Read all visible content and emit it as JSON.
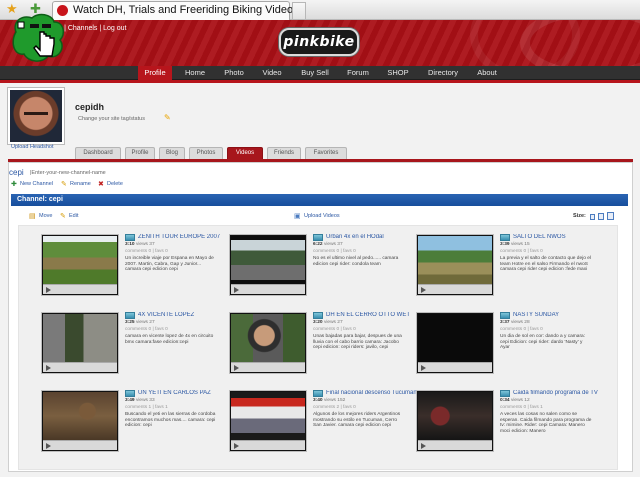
{
  "browser": {
    "tab_title": "Watch DH, Trials and Freeriding Biking Videos"
  },
  "header": {
    "logo_text": "pinkbike",
    "account_links": "...ops | Channels | Log out"
  },
  "nav": {
    "items": [
      "Profile",
      "Home",
      "Photo",
      "Video",
      "Buy Sell",
      "Forum",
      "SHOP",
      "Directory",
      "About"
    ],
    "active": "Profile"
  },
  "profile": {
    "username": "cepidh",
    "tagline": "Change your site tag/status",
    "upload_headshot": "Upload Headshot",
    "tabs": [
      "Dashboard",
      "Profile",
      "Blog",
      "Photos",
      "Videos",
      "Friends",
      "Favorites"
    ],
    "active_tab": "Videos"
  },
  "channel": {
    "name": "cepi",
    "enter_name": "|Enter-your-new-channel-name",
    "actions": [
      "New Channel",
      "Rename",
      "Delete"
    ],
    "bar_title": "Channel: cepi",
    "toolbar": {
      "move": "Move",
      "edit": "Edit",
      "upload": "Upload Videos",
      "size": "Size:"
    }
  },
  "videos": [
    {
      "title": "ZENITH TOUR EUROPE 2007",
      "length": "3:10",
      "views": "views 37",
      "comments": "comments 0 | favs 0",
      "desc": "Un increible viaje por Espana en Mayo de 2007. Martin, Cabra, Gap y Junior... camara cepi edicion cepi"
    },
    {
      "title": "Urban 4x en el HOdal",
      "length": "6:22",
      "views": "views 37",
      "comments": "comments 0 | favs 0",
      "desc": "No es el ultimo nivel al pedo...... camara edicion cepi rider: condola team"
    },
    {
      "title": "SALTO DEL NWOS",
      "length": "3:39",
      "views": "views 15",
      "comments": "comments 0 | favs 0",
      "desc": "La previa y el salto de contacto que dejo el team Hotre en el salso Firmando el nwoS camara cepi rider cepi edicion :fede maxi"
    },
    {
      "title": "4X VICENTE LOPEZ",
      "length": "3:25",
      "views": "views 27",
      "comments": "comments 0 | favs 0",
      "desc": "camara en vicente lopez de 4x en circuito bmx camara:fase edicion:cepi"
    },
    {
      "title": "DH EN EL CERRO OTTO WET",
      "length": "3:20",
      "views": "views 27",
      "comments": "comments 0 | favs 0",
      "desc": "Unas bajadas para bajar, despues de una lluvia con el cabo barrio camara: Jacobo cepi edicion: cepi riders: javilo, cepi"
    },
    {
      "title": "NASTY SUNDAY",
      "length": "3:37",
      "views": "views 28",
      "comments": "comments 0 | favs 0",
      "desc": "Un dia de sol en cor: dando a y camara: cepi Edicion: cepi rider: dardo 'Nasty' y Ayar"
    },
    {
      "title": "UN YETI EN CARLOS PAZ",
      "length": "3:49",
      "views": "views 33",
      "comments": "comments 1 | favs 1",
      "desc": "Buscando el yeti en las sierras de cordoba encontramos muchos mas.... camara: cepi edicion: cepi"
    },
    {
      "title": "Final nacional descenso Tucuman 2007",
      "length": "3:40",
      "views": "views 152",
      "comments": "comments 2 | favs 0",
      "desc": "Algunos de los mejores riders Argentinos mostrando su estilo en Tucuman, Cerro San Javier. camara cepi edicion cepi"
    },
    {
      "title": "Caida filmando programa de TV",
      "length": "0:34",
      "views": "views 12",
      "comments": "comments 0 | favs 1",
      "desc": "A veces las cosas no salen como se esperan. Caida filmando para programa de tv: mimine. Rider: cepi Camara: Manero moci edicion: Manero"
    }
  ],
  "colors": {
    "brand_red": "#b7151c",
    "nav_dark": "#313131",
    "link_blue": "#2b57a3",
    "channel_bar_blue": "#2a64b3"
  }
}
